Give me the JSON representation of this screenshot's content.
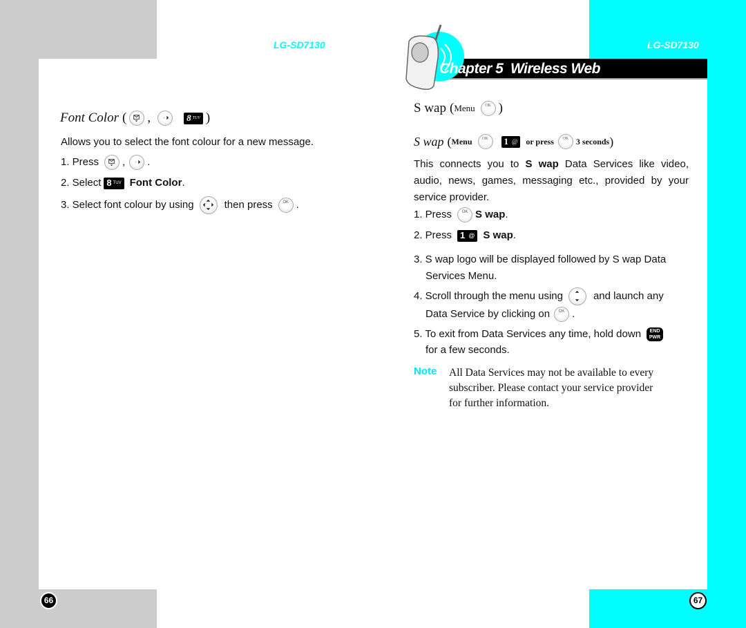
{
  "pages": {
    "left": {
      "model": "LG-SD7130",
      "page_number": "66",
      "section": {
        "title": "Font Color",
        "title_open": "(",
        "title_sep": ",",
        "title_close": ")",
        "title_keys": [
          "message-key-icon",
          "nav-right-key-icon",
          "key-8-tuv-icon"
        ],
        "description": "Allows you to select the font colour for a new message.",
        "steps": [
          {
            "prefix": "1. Press",
            "sep": ",",
            "suffix": "."
          },
          {
            "prefix": "2. Select",
            "bold": "Font Color",
            "suffix": "."
          },
          {
            "prefix": "3. Select font colour by using",
            "middle": "then press",
            "suffix": "."
          }
        ]
      }
    },
    "right": {
      "model": "LG-SD7130",
      "page_number": "67",
      "chapter_title": "Chapter 5  Wireless Web",
      "heading": {
        "title": "S wap",
        "menu_label": "Menu",
        "close": ")",
        "open": "("
      },
      "subheading": {
        "title": "S wap",
        "open": "(",
        "menu_label": "Menu",
        "or_press": "or press",
        "seconds": "3 seconds",
        "close": ")"
      },
      "intro": {
        "before": "This connects you to ",
        "bold": "S wap",
        "after": " Data Services like video, audio, news, games, messaging etc., provided by your service provider."
      },
      "steps": [
        {
          "prefix": "1. Press",
          "bold": "S wap",
          "suffix": "."
        },
        {
          "prefix": "2. Press",
          "bold": "S wap",
          "suffix": "."
        },
        {
          "line1": "3. S wap logo will be displayed followed by S wap Data",
          "line2": "Services Menu."
        },
        {
          "prefix": "4. Scroll through the menu using",
          "middle": "and launch any",
          "line2": "Data Service by clicking on",
          "suffix": "."
        },
        {
          "line1": "5. To exit from Data Services any time, hold down",
          "line2": "for a few seconds."
        }
      ],
      "note": {
        "label": "Note",
        "lines": [
          "All Data Services may not be available to every",
          "subscriber.  Please contact your service provider",
          "for further information."
        ]
      }
    }
  },
  "keys": {
    "ok_label": "OK",
    "ok_sub": "S wap",
    "key8_digit": "8",
    "key8_letters": "TUV",
    "key1_digit": "1",
    "key1_symbol": "@",
    "end_top": "END",
    "end_bottom": "PWR"
  },
  "colors": {
    "accent_cyan": "#00ffff",
    "gray": "#cccccc",
    "note_color": "#00e5ff"
  }
}
